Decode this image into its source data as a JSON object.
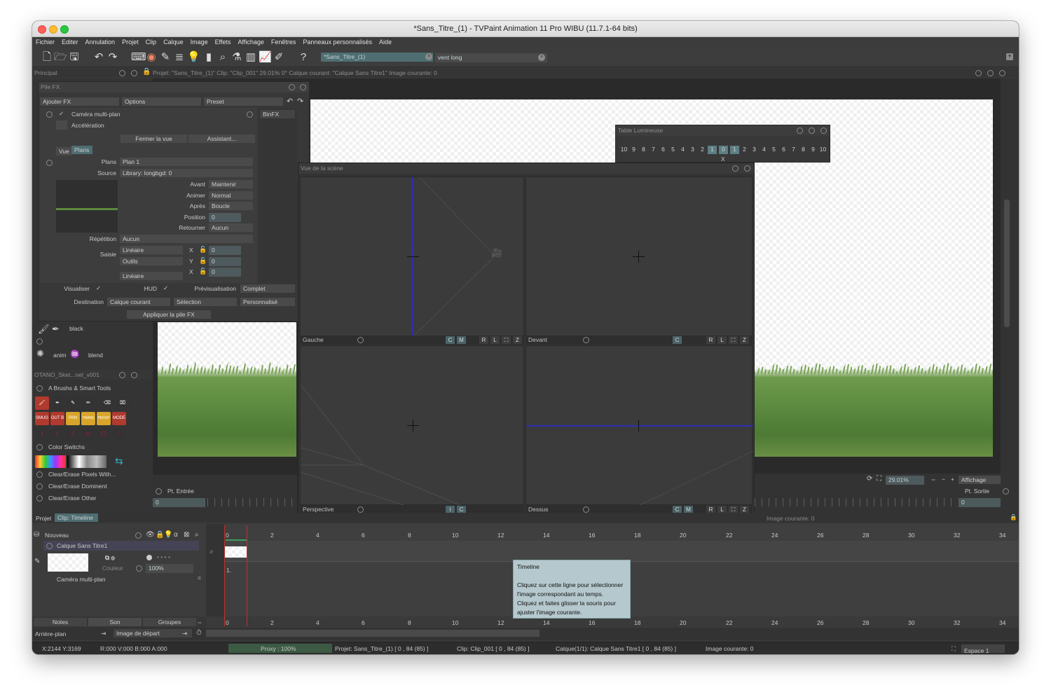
{
  "window": {
    "title": "*Sans_Titre_(1) - TVPaint Animation 11 Pro WIBU (11.7.1-64 bits)"
  },
  "menu": [
    "Fichier",
    "Editer",
    "Annulation",
    "Projet",
    "Clip",
    "Calque",
    "Image",
    "Effets",
    "Affichage",
    "Fenêtres",
    "Panneaux personnalisés",
    "Aide"
  ],
  "toolbar": {
    "tab_project": "*Sans_Titre_(1)",
    "field_brush": "vent long"
  },
  "principal": {
    "label": "Principal",
    "info": "Projet: \"Sans_Titre_(1)\"  Clip: \"Clip_001\"  29.01%   0°  Calque courant: \"Calque Sans Titre1\"  Image courante: 0"
  },
  "pile_fx": {
    "title": "Pile FX",
    "add_fx": "Ajouter FX",
    "options": "Options",
    "preset": "Preset",
    "binfx": "BinFX",
    "fx_name": "Caméra multi-plan",
    "acceleration": "Accélération",
    "close_view": "Fermer la vue",
    "assistant": "Assistant...",
    "tab_vue": "Vue",
    "tab_plans": "Plans",
    "plans_label": "Plans",
    "plans_value": "Plan 1",
    "source_label": "Source",
    "source_value": "Library: longbgd: 0",
    "avant_label": "Avant",
    "avant_value": "Maintenir",
    "animer_label": "Animer",
    "animer_value": "Normal",
    "apres_label": "Après",
    "apres_value": "Boucle",
    "position_label": "Position",
    "position_value": "0",
    "retourner_label": "Retourner",
    "retourner_value": "Aucun",
    "repetition_label": "Répétition",
    "repetition_value": "Aucun",
    "saisie_label": "Saisie",
    "saisie_value1": "Linéaire",
    "saisie_value2": "Outils",
    "saisie_value3": "Linéaire",
    "x_label": "X",
    "y_label": "Y",
    "x_value": "0",
    "y_value": "0",
    "x2_value": "0",
    "visualiser": "Visualiser",
    "hud": "HUD",
    "previsualisation": "Prévisualisation",
    "previsualisation_value": "Complet",
    "destination": "Destination",
    "destination_value": "Calque courant",
    "selection": "Sélection",
    "personnalise": "Personnalisé",
    "apply": "Appliquer la pile FX"
  },
  "brushes": {
    "black": "black",
    "anim": "anim",
    "blend": "blend"
  },
  "tools_panel": {
    "title": "OTANO_Sket...nel_v001",
    "group1": "A Brushs & Smart Tools",
    "tools_row2": [
      "SMUG",
      "OUT B",
      "PAN",
      "TRANS",
      "PERSP",
      "MODE"
    ],
    "group2": "Color Switchs",
    "item1": "Clear/Erase Pixels With...",
    "item2": "Clear/Erase Dominent",
    "item3": "Clear/Erase Other"
  },
  "table_lumineuse": {
    "title": "Table Lumineuse",
    "cells": [
      "10",
      "9",
      "8",
      "7",
      "6",
      "5",
      "4",
      "3",
      "2",
      "1",
      "0",
      "1",
      "2",
      "3",
      "4",
      "5",
      "6",
      "7",
      "8",
      "9",
      "10"
    ],
    "x": "X"
  },
  "scene_view": {
    "title": "Vue de la scène",
    "views": [
      {
        "name": "Gauche",
        "buttons": [
          "C",
          "M",
          "R",
          "L",
          "Z"
        ]
      },
      {
        "name": "Devant",
        "buttons": [
          "C",
          "R",
          "L",
          "Z"
        ]
      },
      {
        "name": "Perspective",
        "buttons": [
          "I",
          "C"
        ]
      },
      {
        "name": "Dessus",
        "buttons": [
          "C",
          "M",
          "R",
          "L",
          "Z"
        ]
      }
    ]
  },
  "viewer": {
    "zoom": "29.01%",
    "affichage": "Affichage",
    "pt_entree": "Pt. Entrée",
    "pt_sortie": "Pt. Sortie",
    "in_value": "0",
    "out_value": "0"
  },
  "timeline": {
    "tab_projet": "Projet",
    "tab_clip": "Clip: Timeline",
    "image_courante": "Image courante: 0",
    "nouveau": "Nouveau",
    "layer_name": "Calque Sans Titre1",
    "couleur": "Couleur",
    "opacity": "100%",
    "camera": "Caméra multi-plan",
    "frame_marker": "1.",
    "ruler": [
      "0",
      "2",
      "4",
      "6",
      "8",
      "10",
      "12",
      "14",
      "16",
      "18",
      "20",
      "22",
      "24",
      "26",
      "28",
      "30",
      "32",
      "34"
    ],
    "tabs": [
      "Notes",
      "Son",
      "Groupes"
    ],
    "arriere_plan": "Arrière-plan",
    "image_depart": "Image de départ"
  },
  "tooltip": {
    "title": "Timeline",
    "body1": "Cliquez sur cette ligne pour sélectionner",
    "body2": "l'image correspondant au temps.",
    "body3": "Cliquez et faites glisser la souris pour",
    "body4": "ajuster l'image courante."
  },
  "status": {
    "coords": "X:2144  Y:3169",
    "color": "R:000 V:000 B:000 A:000",
    "proxy": "Proxy : 100%",
    "project": "Projet: Sans_Titre_(1) [ 0 , 84  (85) ]",
    "clip": "Clip: Clip_001 [ 0 , 84  (85) ]",
    "layer": "Calque(1/1): Calque Sans Titre1 [ 0 , 84  (85) ]",
    "image": "Image courante: 0",
    "space": "Espace 1"
  }
}
